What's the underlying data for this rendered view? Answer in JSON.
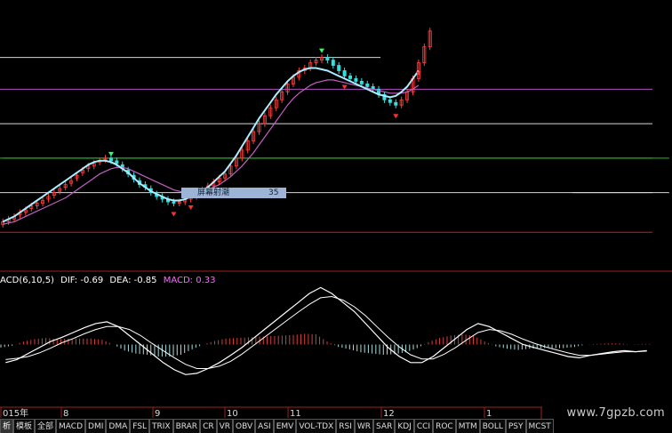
{
  "colors": {
    "up": "#ff4040",
    "down": "#33e0e0",
    "ma_short": "#aaeeff",
    "ma_long": "#c060c0",
    "dif": "#ffffff",
    "dea": "#ffffff",
    "macd_label": "#ff66ff",
    "grid_white": "#d8d8d8",
    "grid_green": "#22c022",
    "grid_violet": "#b050c0",
    "grid_red": "#c02020",
    "buy_arrow": "#ff3030",
    "sell_arrow": "#30ff60"
  },
  "macd_header": {
    "name": "ACD(6,10,5)",
    "dif_label": "DIF: -0.69",
    "dea_label": "DEA: -0.85",
    "macd_label": "MACD: 0.33"
  },
  "popup": {
    "label": "屏幕射潮",
    "value": "35"
  },
  "date_axis": {
    "labels": [
      "015年",
      "8",
      "9",
      "10",
      "11",
      "12",
      "1"
    ]
  },
  "tabs": [
    {
      "label": "析",
      "icon": "",
      "active": true
    },
    {
      "label": "模板",
      "icon": "",
      "active": false
    },
    {
      "label": "全部",
      "icon": "",
      "active": false
    },
    {
      "label": "MACD",
      "icon": "",
      "active": false
    },
    {
      "label": "DMI",
      "icon": "",
      "active": false
    },
    {
      "label": "DMA",
      "icon": "",
      "active": false
    },
    {
      "label": "FSL",
      "icon": "",
      "active": false
    },
    {
      "label": "TRIX",
      "icon": "",
      "active": false
    },
    {
      "label": "BRAR",
      "icon": "",
      "active": false
    },
    {
      "label": "CR",
      "icon": "",
      "active": false
    },
    {
      "label": "VR",
      "icon": "",
      "active": false
    },
    {
      "label": "OBV",
      "icon": "",
      "active": false
    },
    {
      "label": "ASI",
      "icon": "",
      "active": false
    },
    {
      "label": "EMV",
      "icon": "",
      "active": false
    },
    {
      "label": "VOL-TDX",
      "icon": "",
      "active": false
    },
    {
      "label": "RSI",
      "icon": "",
      "active": false
    },
    {
      "label": "WR",
      "icon": "",
      "active": false
    },
    {
      "label": "SAR",
      "icon": "",
      "active": false
    },
    {
      "label": "KDJ",
      "icon": "",
      "active": false
    },
    {
      "label": "CCI",
      "icon": "",
      "active": false
    },
    {
      "label": "ROC",
      "icon": "",
      "active": false
    },
    {
      "label": "MTM",
      "icon": "",
      "active": false
    },
    {
      "label": "BOLL",
      "icon": "",
      "active": false
    },
    {
      "label": "PSY",
      "icon": "",
      "active": false
    },
    {
      "label": "MCST",
      "icon": "",
      "active": false
    }
  ],
  "watermark": "www.7gpzb.com",
  "chart_data": {
    "type": "candlestick",
    "price_panel": {
      "ylim": [
        0,
        100
      ],
      "levels": [
        {
          "value": 80,
          "color": "white"
        },
        {
          "value": 68,
          "color": "violet"
        },
        {
          "value": 55,
          "color": "white"
        },
        {
          "value": 42,
          "color": "green"
        },
        {
          "value": 29,
          "color": "white"
        },
        {
          "value": 14,
          "color": "red"
        }
      ],
      "segment_levels": [
        {
          "value": 29,
          "x_from": 100,
          "x_to": 117,
          "color": "white"
        },
        {
          "value": 42,
          "x_from": 0,
          "x_to": 117,
          "color": "green"
        }
      ],
      "candles_x": [
        0,
        1,
        2,
        3,
        4,
        5,
        6,
        7,
        8,
        9,
        10,
        11,
        12,
        13,
        14,
        15,
        16,
        17,
        18,
        19,
        20,
        21,
        22,
        23,
        24,
        25,
        26,
        27,
        28,
        29,
        30,
        31,
        32,
        33,
        34,
        35,
        36,
        37,
        38,
        39,
        40,
        41,
        42,
        43,
        44,
        45,
        46,
        47,
        48,
        49,
        50,
        51,
        52,
        53,
        54,
        55,
        56,
        57,
        58,
        59,
        60,
        61,
        62,
        63,
        64,
        65,
        66,
        67,
        68,
        69,
        70,
        71,
        72,
        73,
        74,
        75,
        76,
        77,
        78,
        79,
        80,
        81,
        82,
        83,
        84,
        85,
        86,
        87,
        88,
        89,
        90,
        91,
        92,
        93,
        94,
        95,
        96,
        97,
        98,
        99,
        100,
        101,
        102,
        103,
        104,
        105,
        106,
        107,
        108,
        109,
        110,
        111,
        112,
        113,
        114,
        115,
        116,
        117
      ],
      "close": [
        18,
        19,
        20,
        21.5,
        22.5,
        24,
        25,
        26,
        27.5,
        29,
        30.5,
        32,
        33.5,
        35.5,
        37.5,
        39,
        40,
        41,
        42,
        41,
        40,
        38,
        36,
        34,
        32,
        31,
        29,
        27.5,
        26.5,
        25.5,
        25,
        25.5,
        26.5,
        27.5,
        28.5,
        30,
        31.5,
        33,
        34.5,
        36,
        39,
        42,
        45,
        48.5,
        52,
        55,
        58,
        61,
        64,
        67,
        70,
        72.5,
        75,
        76,
        78,
        79,
        80,
        79,
        77,
        75,
        73,
        72,
        71,
        70,
        69,
        68,
        66,
        64,
        63,
        62,
        64,
        67,
        72,
        78,
        84,
        90,
        null,
        null,
        null,
        null,
        null,
        null,
        null,
        null,
        null,
        null,
        null,
        null,
        null,
        null,
        null,
        null,
        null,
        null,
        null,
        null,
        null,
        null,
        null,
        null,
        null,
        null,
        null,
        null,
        null,
        null,
        null,
        null,
        null,
        null,
        null,
        null,
        null,
        null,
        null,
        null,
        null,
        null
      ],
      "open": [
        17,
        18,
        19,
        20.5,
        21.5,
        23,
        24,
        25,
        26.5,
        28,
        29.5,
        31,
        32.5,
        34.5,
        36.5,
        38,
        39,
        40.5,
        41.5,
        42,
        41,
        39.5,
        37.5,
        35.5,
        33.5,
        32,
        30.5,
        28.5,
        27.5,
        26.5,
        25.5,
        25,
        25.5,
        26.5,
        27.5,
        28.5,
        30,
        31.5,
        33,
        34.5,
        36,
        39,
        42,
        45,
        48.5,
        52,
        55,
        58,
        61,
        64,
        67,
        70,
        72.5,
        75,
        76,
        78,
        79,
        80,
        79,
        77,
        75,
        73,
        72,
        71,
        70,
        69,
        68,
        66,
        64,
        63,
        62,
        64,
        67,
        72,
        78,
        84,
        null,
        null,
        null,
        null,
        null,
        null,
        null,
        null,
        null,
        null,
        null,
        null,
        null,
        null,
        null,
        null,
        null,
        null,
        null,
        null,
        null,
        null,
        null,
        null,
        null,
        null,
        null,
        null,
        null,
        null,
        null,
        null,
        null,
        null,
        null,
        null,
        null,
        null,
        null,
        null,
        null,
        null
      ],
      "ma_short": [
        18,
        19,
        20,
        21.5,
        23,
        24.5,
        26,
        27.5,
        29,
        30.5,
        32,
        33.5,
        35,
        36.5,
        38,
        39.5,
        40.5,
        41,
        41,
        40.5,
        39.5,
        38,
        36.5,
        34.5,
        32.5,
        31,
        29.5,
        28.5,
        27.5,
        26.5,
        26,
        26,
        26.5,
        27.5,
        28.5,
        29.5,
        31,
        33,
        35,
        37,
        40,
        43,
        46.5,
        50,
        53.5,
        57,
        60,
        63,
        66,
        68.5,
        71,
        73,
        74.5,
        75.5,
        76,
        76,
        75.5,
        75,
        74,
        73,
        72,
        71,
        70,
        69,
        68,
        67,
        66,
        65.5,
        65,
        65.5,
        67,
        69,
        72,
        75,
        null,
        null,
        null,
        null,
        null,
        null,
        null,
        null,
        null,
        null,
        null,
        null,
        null,
        null,
        null,
        null,
        null,
        null,
        null,
        null,
        null,
        null,
        null,
        null,
        null,
        null,
        null,
        null,
        null,
        null,
        null,
        null,
        null,
        null,
        null,
        null,
        null,
        null,
        null,
        null,
        null,
        null,
        null,
        null
      ],
      "ma_long": [
        17,
        17.5,
        18,
        19,
        20,
        21,
        22,
        23,
        24,
        25,
        26,
        27,
        28.5,
        30,
        31.5,
        33,
        34.5,
        36,
        37,
        38,
        38.5,
        38.5,
        38,
        37,
        36,
        35,
        34,
        33,
        32,
        31,
        30,
        29.5,
        29,
        29,
        29,
        29.5,
        30,
        31,
        32,
        33.5,
        35,
        37,
        39,
        41.5,
        44,
        47,
        50,
        53,
        56,
        59,
        62,
        64.5,
        66.5,
        68,
        69.5,
        70.5,
        71,
        71.5,
        71.5,
        71,
        70.5,
        70,
        69.5,
        69,
        68.5,
        68,
        67.5,
        67,
        66.5,
        66.5,
        66.5,
        67,
        68,
        69.5,
        null,
        null,
        null,
        null,
        null,
        null,
        null,
        null,
        null,
        null,
        null,
        null,
        null,
        null,
        null,
        null,
        null,
        null,
        null,
        null,
        null,
        null,
        null,
        null,
        null,
        null,
        null,
        null,
        null,
        null,
        null,
        null,
        null,
        null,
        null,
        null,
        null,
        null,
        null,
        null,
        null,
        null,
        null,
        null
      ]
    },
    "macd_panel": {
      "ylim": [
        -1,
        1
      ],
      "dif": [
        -0.3,
        -0.25,
        -0.15,
        -0.05,
        0.05,
        0.12,
        0.2,
        0.28,
        0.35,
        0.38,
        0.3,
        0.15,
        0.0,
        -0.15,
        -0.3,
        -0.42,
        -0.5,
        -0.48,
        -0.4,
        -0.3,
        -0.18,
        -0.05,
        0.1,
        0.25,
        0.4,
        0.55,
        0.7,
        0.85,
        0.95,
        0.85,
        0.7,
        0.55,
        0.35,
        0.15,
        -0.05,
        -0.2,
        -0.3,
        -0.3,
        -0.2,
        -0.05,
        0.1,
        0.25,
        0.35,
        0.3,
        0.2,
        0.1,
        0.0,
        -0.05,
        -0.1,
        -0.15,
        -0.2,
        -0.22,
        -0.18,
        -0.15,
        -0.12,
        -0.1,
        -0.12,
        -0.1
      ],
      "dea": [
        -0.25,
        -0.23,
        -0.2,
        -0.14,
        -0.06,
        0.03,
        0.1,
        0.18,
        0.25,
        0.3,
        0.3,
        0.25,
        0.15,
        0.02,
        -0.1,
        -0.22,
        -0.33,
        -0.4,
        -0.4,
        -0.36,
        -0.28,
        -0.16,
        -0.02,
        0.12,
        0.26,
        0.4,
        0.54,
        0.67,
        0.78,
        0.8,
        0.74,
        0.63,
        0.48,
        0.3,
        0.12,
        -0.04,
        -0.17,
        -0.24,
        -0.24,
        -0.16,
        -0.05,
        0.08,
        0.2,
        0.25,
        0.23,
        0.17,
        0.09,
        0.02,
        -0.04,
        -0.09,
        -0.14,
        -0.18,
        -0.18,
        -0.16,
        -0.14,
        -0.12,
        -0.12,
        -0.11
      ],
      "hist": [
        -0.05,
        -0.02,
        0.05,
        0.09,
        0.11,
        0.09,
        0.1,
        0.1,
        0.1,
        0.08,
        0.0,
        -0.1,
        -0.15,
        -0.17,
        -0.2,
        -0.2,
        -0.17,
        -0.08,
        0.0,
        0.06,
        0.1,
        0.11,
        0.12,
        0.13,
        0.14,
        0.15,
        0.16,
        0.18,
        0.17,
        0.05,
        -0.04,
        -0.08,
        -0.13,
        -0.15,
        -0.17,
        -0.16,
        -0.13,
        -0.06,
        0.04,
        0.11,
        0.15,
        0.17,
        0.15,
        0.05,
        -0.03,
        -0.07,
        -0.09,
        -0.07,
        -0.06,
        -0.06,
        -0.06,
        -0.04,
        0.0,
        0.01,
        0.02,
        0.02,
        0.0,
        0.01
      ]
    }
  }
}
